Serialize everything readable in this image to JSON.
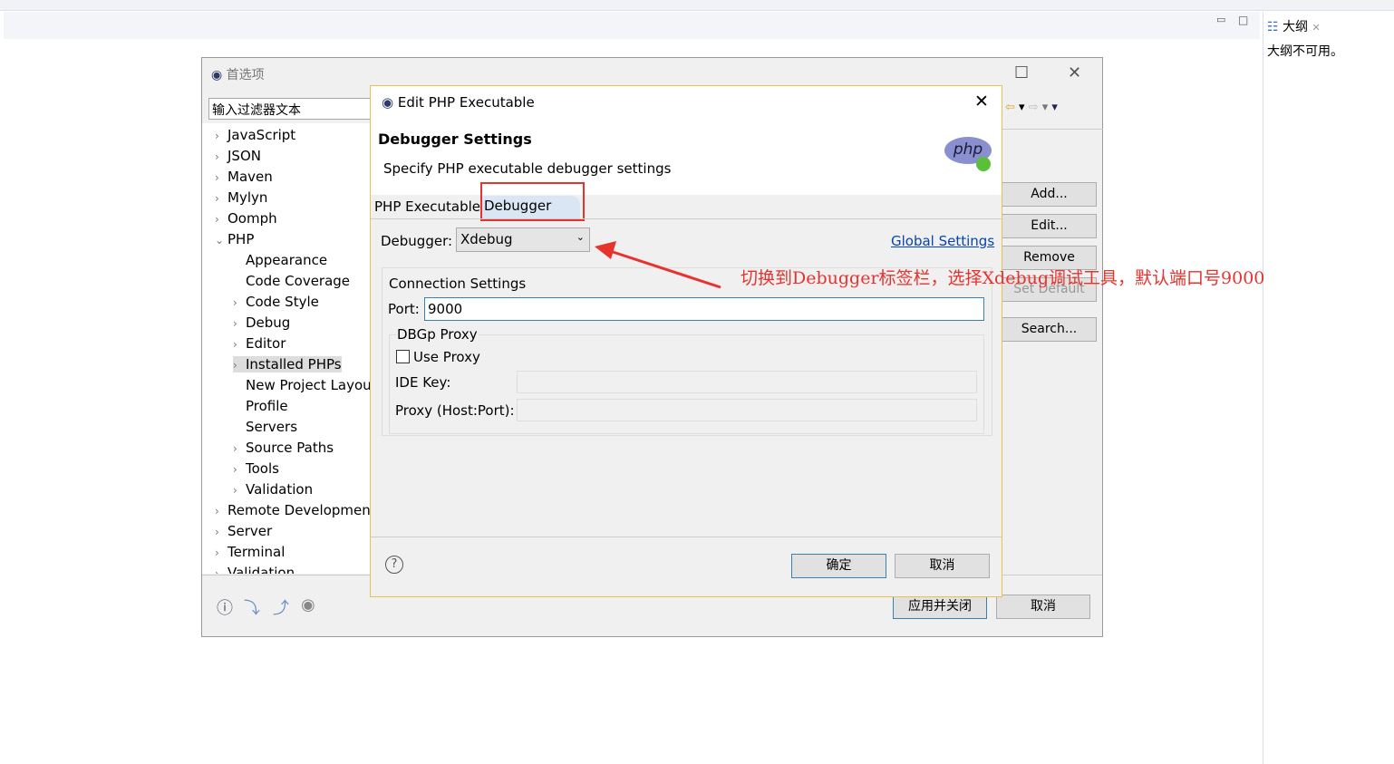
{
  "outline": {
    "tab": "大纲",
    "message": "大纲不可用。"
  },
  "preferences": {
    "title": "首选项",
    "filter_placeholder": "输入过滤器文本",
    "tree": [
      {
        "label": "JavaScript",
        "level": 0,
        "exp": ">"
      },
      {
        "label": "JSON",
        "level": 0,
        "exp": ">"
      },
      {
        "label": "Maven",
        "level": 0,
        "exp": ">"
      },
      {
        "label": "Mylyn",
        "level": 0,
        "exp": ">"
      },
      {
        "label": "Oomph",
        "level": 0,
        "exp": ">"
      },
      {
        "label": "PHP",
        "level": 0,
        "exp": "v"
      },
      {
        "label": "Appearance",
        "level": 1,
        "exp": ""
      },
      {
        "label": "Code Coverage",
        "level": 1,
        "exp": ""
      },
      {
        "label": "Code Style",
        "level": 1,
        "exp": ">"
      },
      {
        "label": "Debug",
        "level": 1,
        "exp": ">"
      },
      {
        "label": "Editor",
        "level": 1,
        "exp": ">"
      },
      {
        "label": "Installed PHPs",
        "level": 1,
        "exp": ">",
        "selected": true
      },
      {
        "label": "New Project Layout",
        "level": 1,
        "exp": ""
      },
      {
        "label": "Profile",
        "level": 1,
        "exp": ""
      },
      {
        "label": "Servers",
        "level": 1,
        "exp": ""
      },
      {
        "label": "Source Paths",
        "level": 1,
        "exp": ">"
      },
      {
        "label": "Tools",
        "level": 1,
        "exp": ">"
      },
      {
        "label": "Validation",
        "level": 1,
        "exp": ">"
      },
      {
        "label": "Remote Development",
        "level": 0,
        "exp": ">"
      },
      {
        "label": "Server",
        "level": 0,
        "exp": ">"
      },
      {
        "label": "Terminal",
        "level": 0,
        "exp": ">"
      },
      {
        "label": "Validation",
        "level": 0,
        "exp": ">"
      }
    ],
    "side_buttons": [
      "Add...",
      "Edit...",
      "Remove",
      "Set Default",
      "Search..."
    ],
    "apply_close": "应用并关闭",
    "cancel": "取消"
  },
  "dialog": {
    "title": "Edit PHP Executable",
    "heading": "Debugger Settings",
    "subtitle": "Specify PHP executable debugger settings",
    "logo": "php",
    "tabs": [
      "PHP Executable",
      "Debugger"
    ],
    "debugger_label": "Debugger:",
    "debugger_value": "Xdebug",
    "global_settings": "Global Settings",
    "connection_group": "Connection Settings",
    "port_label": "Port:",
    "port_value": "9000",
    "proxy_group": "DBGp Proxy",
    "use_proxy": "Use Proxy",
    "use_proxy_checked": false,
    "ide_key_label": "IDE Key:",
    "ide_key_value": "",
    "proxy_label": "Proxy (Host:Port):",
    "proxy_value": "",
    "ok": "确定",
    "cancel": "取消"
  },
  "annotation": {
    "text": "切换到Debugger标签栏，选择Xdebug调试工具，默认端口号9000",
    "color": "#e8322e"
  }
}
